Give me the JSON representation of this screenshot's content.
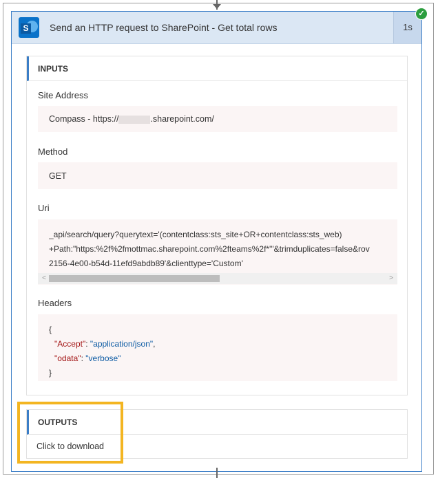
{
  "action": {
    "title": "Send an HTTP request to SharePoint - Get total rows",
    "duration": "1s",
    "status_icon": "check-circle-icon",
    "app_icon": "sharepoint-icon",
    "accent_color": "#3b7ec7",
    "success_color": "#2c9e3f",
    "highlight_color": "#f3b521"
  },
  "inputs": {
    "heading": "INPUTS",
    "site_address": {
      "label": "Site Address",
      "value_prefix": "Compass - https://",
      "value_suffix": ".sharepoint.com/"
    },
    "method": {
      "label": "Method",
      "value": "GET"
    },
    "uri": {
      "label": "Uri",
      "lines": [
        "_api/search/query?querytext='(contentclass:sts_site+OR+contentclass:sts_web)",
        "+Path:\"https:%2f%2fmottmac.sharepoint.com%2fteams%2f*\"'&trimduplicates=false&rov",
        "2156-4e00-b54d-11efd9abdb89'&clienttype='Custom'"
      ]
    },
    "headers": {
      "label": "Headers",
      "open_brace": "{",
      "close_brace": "}",
      "entries": [
        {
          "key": "\"Accept\"",
          "sep": ": ",
          "value": "\"application/json\"",
          "trail": ","
        },
        {
          "key": "\"odata\"",
          "sep": ": ",
          "value": "\"verbose\"",
          "trail": ""
        }
      ]
    }
  },
  "outputs": {
    "heading": "OUTPUTS",
    "download_label": "Click to download"
  }
}
